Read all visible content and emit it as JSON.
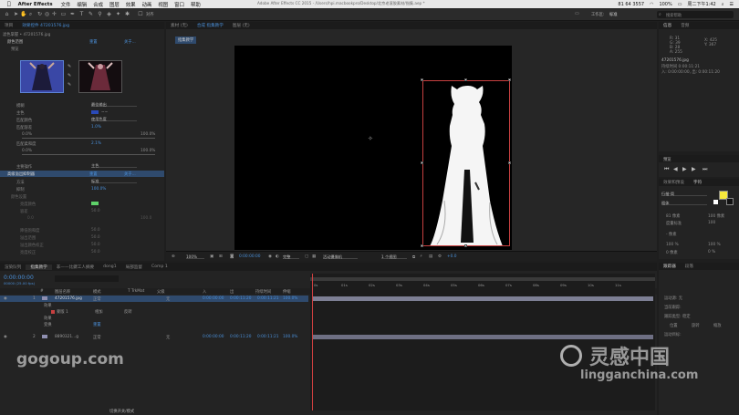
{
  "menubar": {
    "apple": "",
    "app": "After Effects",
    "items": [
      "文件",
      "编辑",
      "合成",
      "图层",
      "效果",
      "动画",
      "视图",
      "窗口",
      "帮助"
    ],
    "phone": "81 64 3557",
    "battery": "100%",
    "clock": "周二下午1:42"
  },
  "toolbar": {
    "title": "Adobe After Effects CC 2015 - /Users/hpi.macbookpro/Desktop/北京老滚胶素材/指集.aep *",
    "workspace_label": "工作区:",
    "workspace_value": "标准",
    "search_placeholder": "搜索帮助",
    "snap_label": "对齐"
  },
  "left": {
    "tabs": [
      "项目",
      "效果控件 47201576.jpg"
    ],
    "header": "滤色掌握 • 47201576.jpg",
    "effect_name": "颜色范围",
    "reset": "重置",
    "about": "关于...",
    "preview_label": "预览",
    "rows": [
      {
        "label": "模糊",
        "value": "最佳输出"
      },
      {
        "label": "主色",
        "value": "~~"
      },
      {
        "label": "匹配颜色",
        "value": "使用色度"
      },
      {
        "label": "匹配容差",
        "value": "1.0%"
      },
      {
        "label": "0.0%",
        "value": "100.0%"
      },
      {
        "label": "匹配柔和度",
        "value": "2.1%"
      },
      {
        "label": "0.0%",
        "value": "100.0%"
      },
      {
        "label": "主要操作",
        "value": "主色"
      },
      {
        "label": "高级溢出抑制器",
        "value": "重置"
      },
      {
        "label": "方法",
        "value": "标准"
      },
      {
        "label": "抑制",
        "value": "100.0%"
      },
      {
        "label": "颜色设置",
        "value": ""
      },
      {
        "label": "亮度颜色",
        "value": ""
      },
      {
        "label": "容差",
        "value": "50.0"
      },
      {
        "label": "0.0",
        "value": "100.0"
      },
      {
        "label": "降低饱和度",
        "value": "50.0"
      },
      {
        "label": "溢出范围",
        "value": "50.0"
      },
      {
        "label": "溢出颜色校正",
        "value": "50.0"
      },
      {
        "label": "亮度校正",
        "value": "50.0"
      }
    ]
  },
  "viewer": {
    "tabs": [
      "素材 (无)",
      "合成 指集教学",
      "图层 (无)"
    ],
    "comp_tab": "指集教学",
    "footer": {
      "zoom": "100%",
      "timecode": "0:00:00:00",
      "quality": "完整",
      "camera": "活动摄像机",
      "views": "1 个视图",
      "offset": "+0.0"
    }
  },
  "info": {
    "tabs": [
      "信息",
      "音频"
    ],
    "r": "R: 31",
    "g": "G: 39",
    "b": "B: 28",
    "a": "A: 255",
    "x": "X: 425",
    "y": "Y: 367",
    "file": "47201576.jpg",
    "dur": "持续时间 0:00:11:21",
    "inout": "入: 0:00:00:00, 出: 0:00:11:20"
  },
  "preview": {
    "title": "预览"
  },
  "character": {
    "tabs": [
      "效果和预设",
      "字符"
    ],
    "font": "行楷-简",
    "style": "粗体",
    "size": "81 像素",
    "leading": "100 像素",
    "tracking": "度量标准",
    "kern": "100",
    "stroke": "- 像素",
    "vscale": "100 %",
    "hscale": "100 %",
    "baseline": "0 像素",
    "tsume": "0 %"
  },
  "paragraph": {
    "tabs": [
      "跟踪器",
      "段落"
    ],
    "rows": [
      "运动源: 无",
      "当前跟踪:",
      "跟踪类型: 稳定",
      "位置",
      "旋转",
      "缩放",
      "运动目标:"
    ]
  },
  "timeline": {
    "tabs": [
      "渲染队列",
      "指集教学",
      "非——比鍵工人摘要",
      "dong1",
      "局部监督",
      "Comp 1"
    ],
    "timecode": "0:00:00:00",
    "fps": "00000 (25.00 fps)",
    "headers": [
      "#",
      "图层名称",
      "模式",
      "T TrkMat",
      "父级",
      "入",
      "出",
      "持续时间",
      "伸缩"
    ],
    "layers": [
      {
        "num": "1",
        "name": "47201576.jpg",
        "mode": "正常",
        "parent": "无",
        "in": "0:00:00:00",
        "out": "0:00:11:20",
        "dur": "0:00:11:21",
        "stretch": "100.0%"
      },
      {
        "num": "",
        "name": "效果",
        "mode": "",
        "parent": "",
        "in": "",
        "out": "",
        "dur": "",
        "stretch": ""
      },
      {
        "num": "",
        "name": "蒙版 1",
        "mode": "相加",
        "parent": "反转",
        "in": "",
        "out": "",
        "dur": "",
        "stretch": ""
      },
      {
        "num": "",
        "name": "效果",
        "mode": "",
        "parent": "",
        "in": "",
        "out": "",
        "dur": "",
        "stretch": ""
      },
      {
        "num": "",
        "name": "变换",
        "mode": "重置",
        "parent": "",
        "in": "",
        "out": "",
        "dur": "",
        "stretch": ""
      },
      {
        "num": "2",
        "name": "8890321...g",
        "mode": "正常",
        "parent": "无",
        "in": "0:00:00:00",
        "out": "0:00:11:20",
        "dur": "0:00:11:21",
        "stretch": "100.0%"
      }
    ],
    "ruler": [
      "0s",
      "01s",
      "02s",
      "03s",
      "04s",
      "05s",
      "06s",
      "07s",
      "08s",
      "09s",
      "10s",
      "11s"
    ],
    "footer": "切换开关/模式"
  },
  "watermarks": {
    "left": "gogoup.com",
    "logo": "灵感中国",
    "url": "lingganchina.com"
  }
}
